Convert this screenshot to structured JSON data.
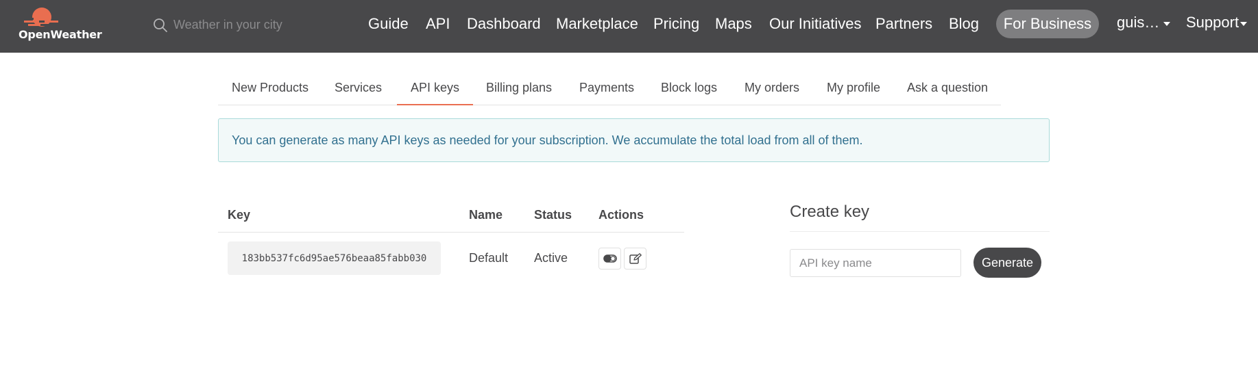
{
  "brand": {
    "name": "OpenWeather",
    "accent": "#e96e50",
    "nav_bg": "#48484a"
  },
  "search": {
    "placeholder": "Weather in your city",
    "value": ""
  },
  "nav": {
    "links": [
      "Guide",
      "API",
      "Dashboard",
      "Marketplace",
      "Pricing",
      "Maps",
      "Our Initiatives",
      "Partners",
      "Blog"
    ],
    "for_business": "For Business",
    "user": "guis…",
    "support": "Support"
  },
  "tabs": {
    "items": [
      "New Products",
      "Services",
      "API keys",
      "Billing plans",
      "Payments",
      "Block logs",
      "My orders",
      "My profile",
      "Ask a question"
    ],
    "active": "API keys"
  },
  "alert": {
    "text": "You can generate as many API keys as needed for your subscription. We accumulate the total load from all of them."
  },
  "keys_table": {
    "headers": {
      "key": "Key",
      "name": "Name",
      "status": "Status",
      "actions": "Actions"
    },
    "rows": [
      {
        "key": "183bb537fc6d95ae576beaa85fabb030",
        "name": "Default",
        "status": "Active",
        "actions": [
          "toggle-icon",
          "edit-icon"
        ]
      }
    ]
  },
  "create_key": {
    "title": "Create key",
    "input_placeholder": "API key name",
    "input_value": "",
    "button_label": "Generate"
  }
}
